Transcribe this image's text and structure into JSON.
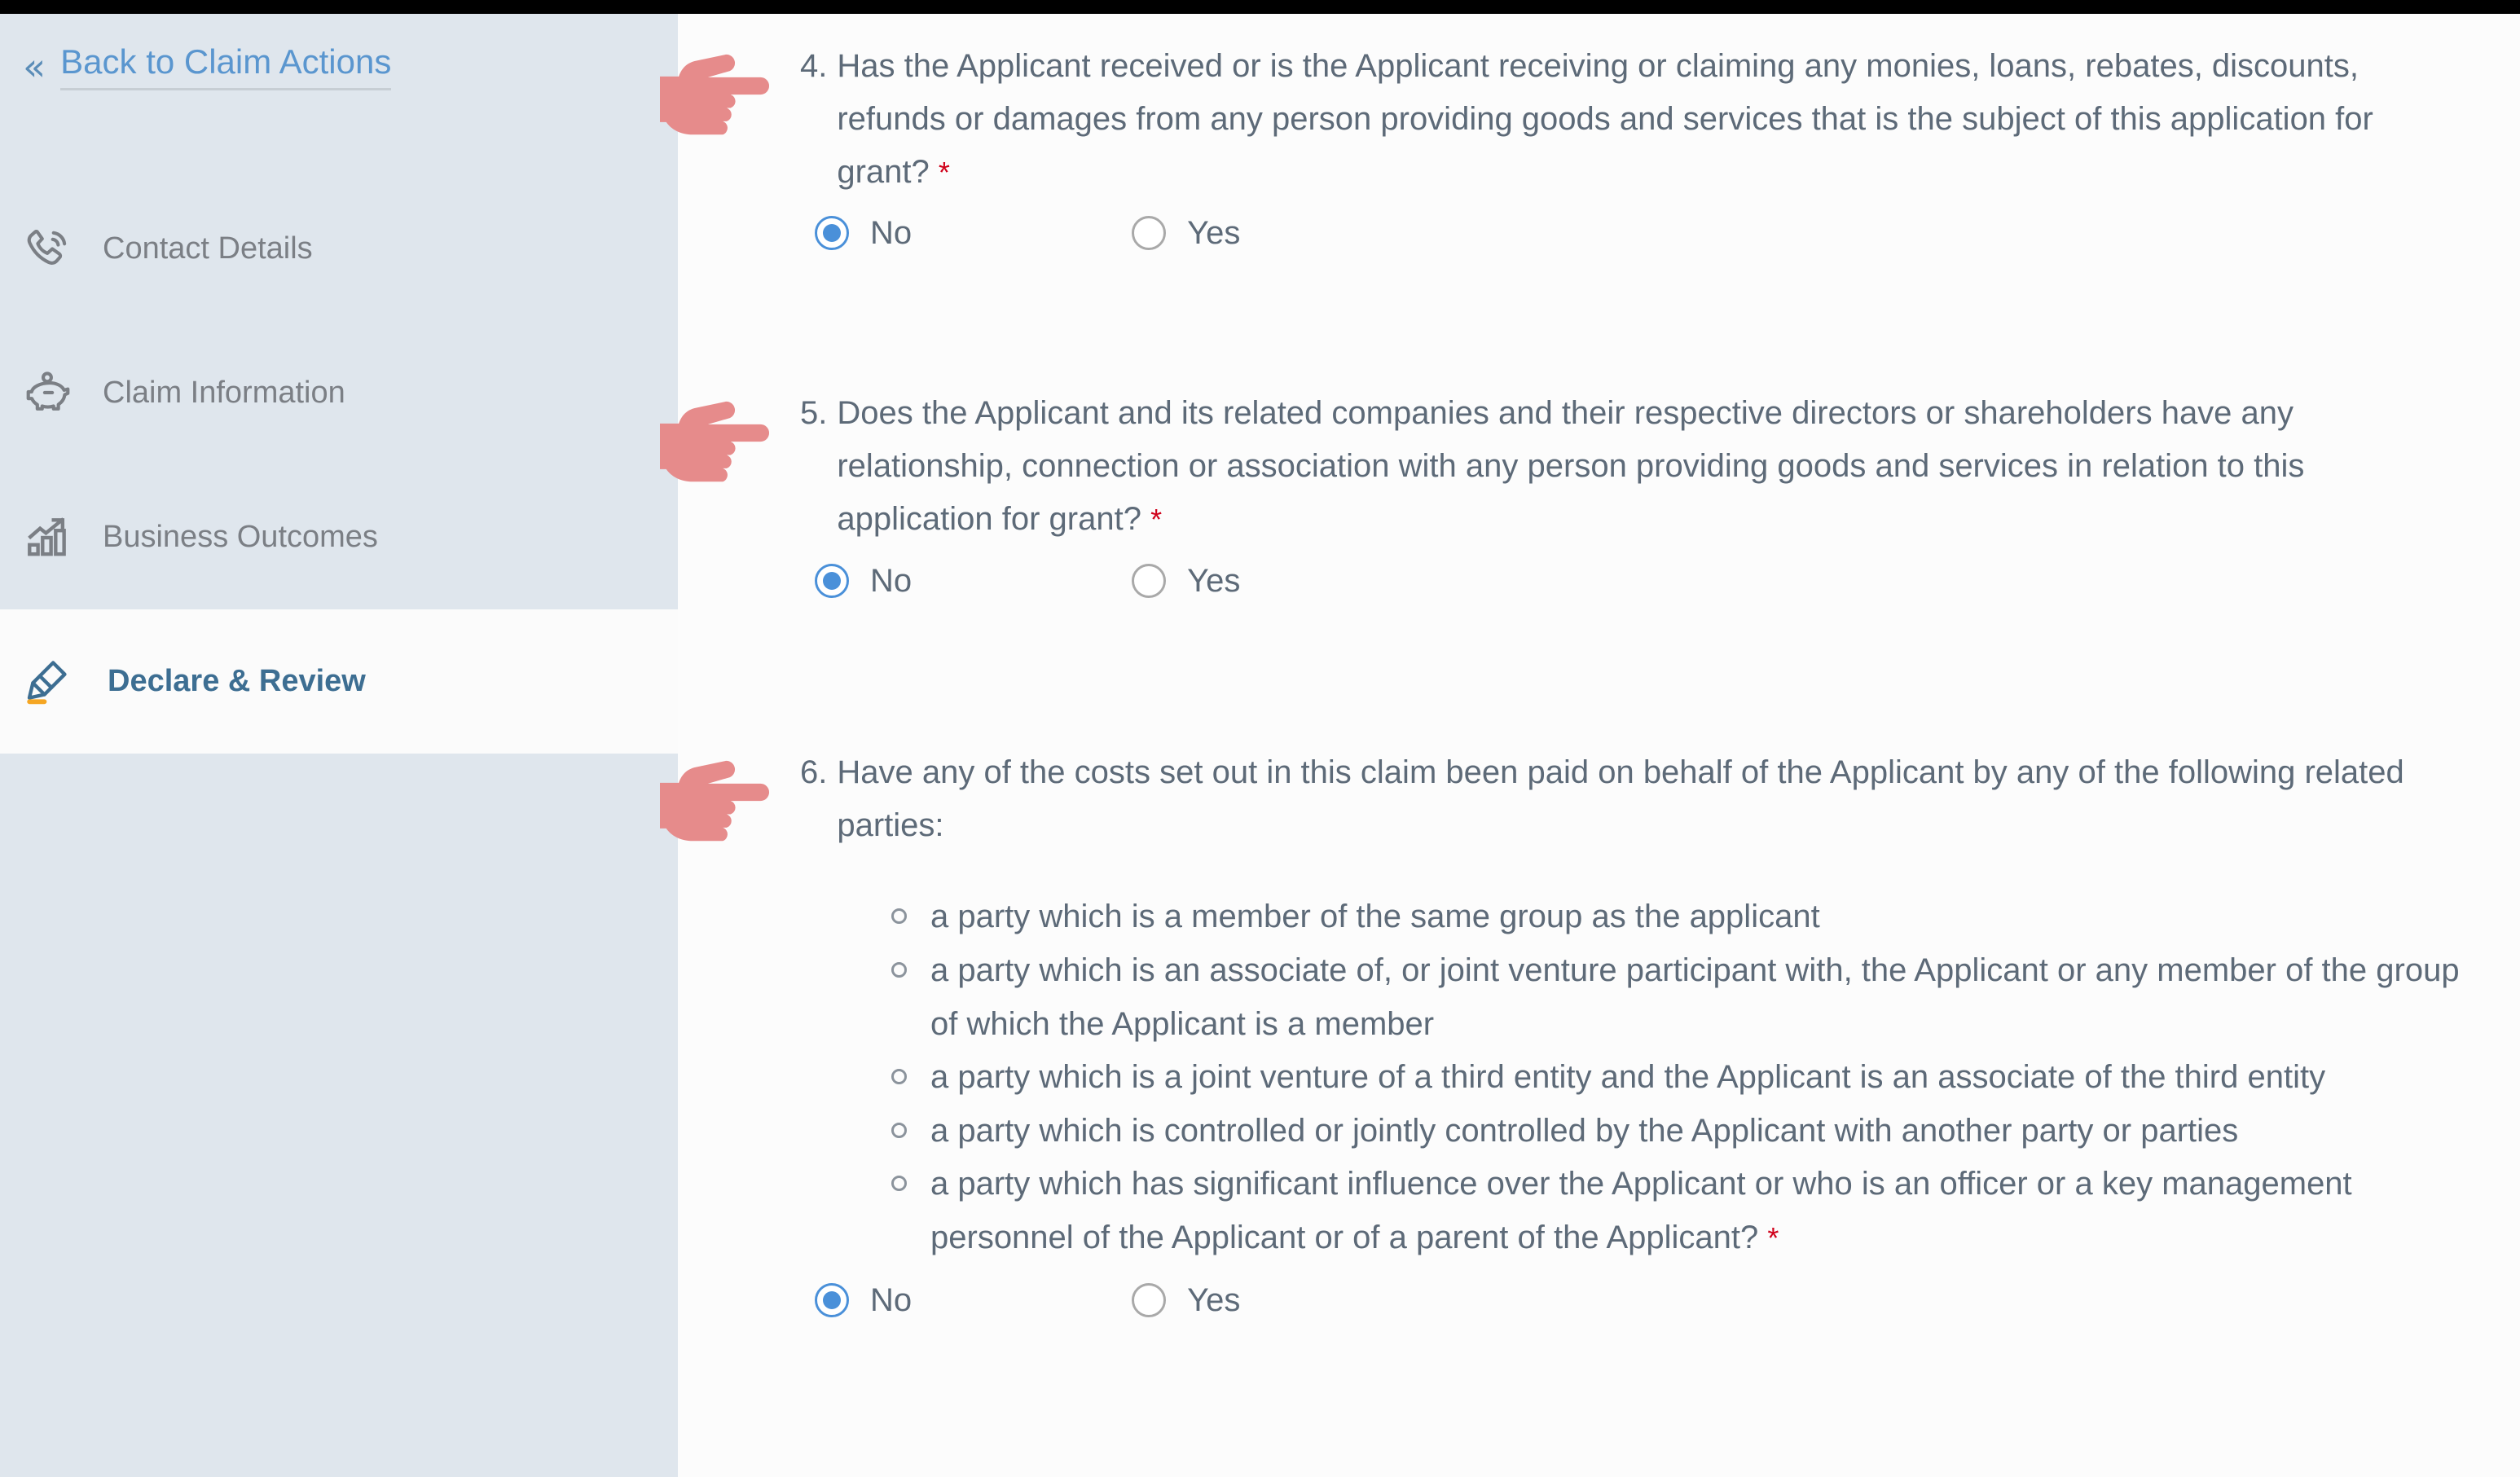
{
  "sidebar": {
    "back_link": {
      "icon": "double-chevron-left-icon",
      "label": "Back to Claim Actions"
    },
    "items": [
      {
        "icon": "phone-call-icon",
        "label": "Contact Details",
        "active": false
      },
      {
        "icon": "piggy-bank-icon",
        "label": "Claim Information",
        "active": false
      },
      {
        "icon": "bar-chart-up-icon",
        "label": "Business Outcomes",
        "active": false
      },
      {
        "icon": "highlighter-pen-icon",
        "label": "Declare & Review",
        "active": true
      }
    ]
  },
  "main": {
    "pointer_icon": "pointing-hand-right-icon",
    "required_marker": "*",
    "questions": [
      {
        "number": "4.",
        "text": "Has the Applicant received or is the Applicant receiving or claiming any monies, loans, rebates, discounts, refunds or damages from any person providing goods and services that is the subject of this application for grant?",
        "options": [
          {
            "label": "No",
            "selected": true
          },
          {
            "label": "Yes",
            "selected": false
          }
        ]
      },
      {
        "number": "5.",
        "text": "Does the Applicant and its related companies and their respective directors or shareholders have any relationship, connection or association with any person providing goods and services in relation to this application for grant?",
        "options": [
          {
            "label": "No",
            "selected": true
          },
          {
            "label": "Yes",
            "selected": false
          }
        ]
      },
      {
        "number": "6.",
        "text": "Have any of the costs set out in this claim been paid on behalf of the Applicant by any of the following related parties:",
        "sublist": [
          "a party which is a member of the same group as the applicant",
          "a party which is an associate of, or joint venture participant with, the Applicant or any member of the group of which the Applicant is a member",
          "a party which is a joint venture of a third entity and the Applicant is an associate of the third entity",
          "a party which is controlled or jointly controlled by the Applicant with another party or parties",
          "a party which has significant influence over the Applicant or who is an officer or a key management personnel of the Applicant or of a parent of the Applicant?"
        ],
        "sublist_required_index": 4,
        "options": [
          {
            "label": "No",
            "selected": true
          },
          {
            "label": "Yes",
            "selected": false
          }
        ]
      }
    ]
  },
  "colors": {
    "sidebar_bg": "#dfe6ed",
    "active_bg": "#fbfbfb",
    "link_blue": "#5a96cf",
    "active_label": "#3d6e92",
    "accent_orange": "#f5a623",
    "text_gray": "#5d6a78",
    "radio_blue": "#4a90d9",
    "required_red": "#d0021b",
    "pointer_pink": "#e68b8b"
  }
}
